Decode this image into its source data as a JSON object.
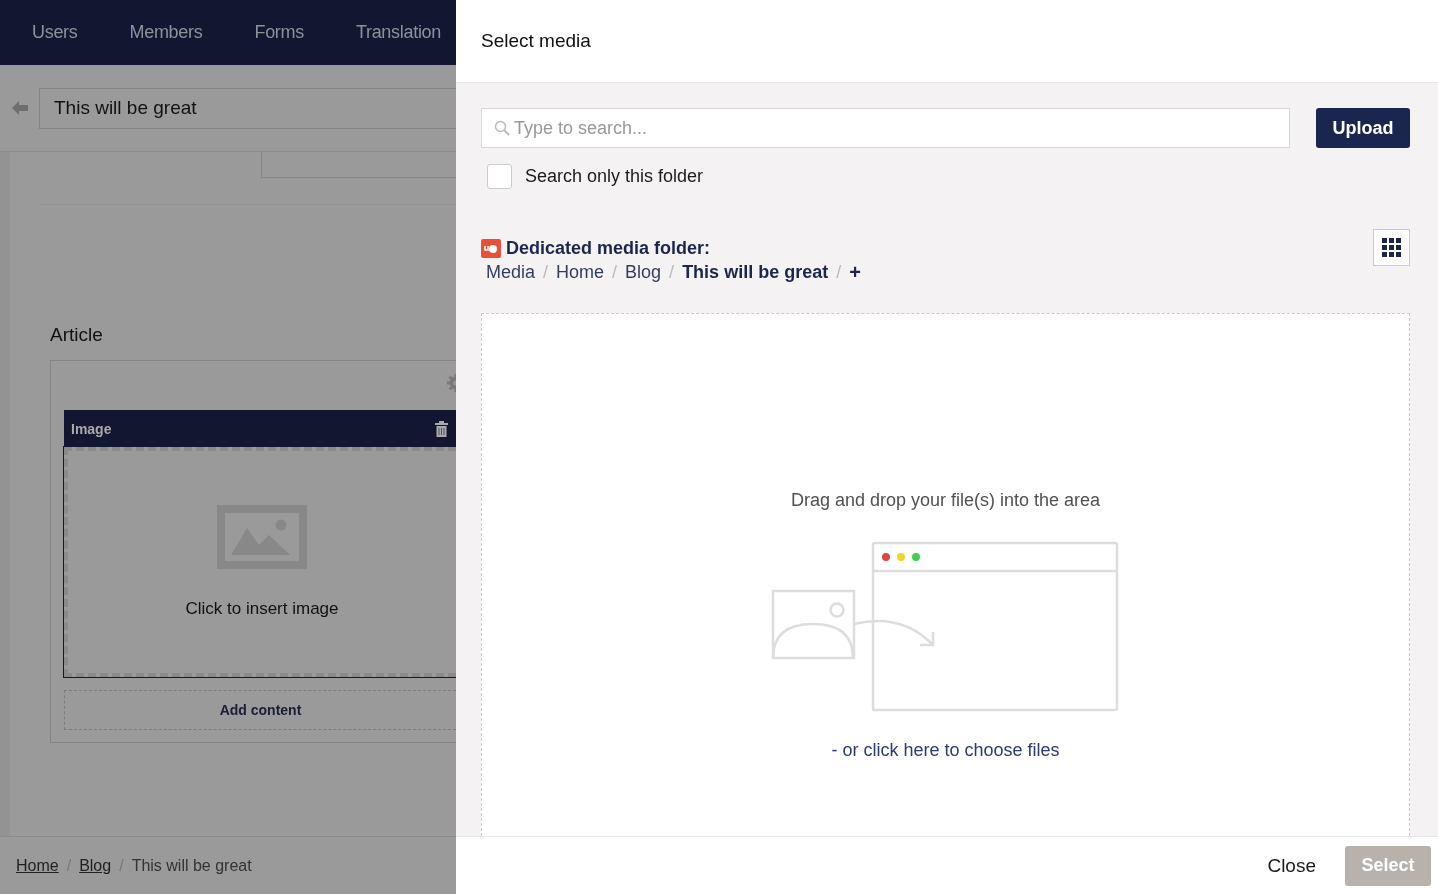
{
  "nav": {
    "items": [
      "Users",
      "Members",
      "Forms",
      "Translation"
    ]
  },
  "editor": {
    "title": "This will be great",
    "section_title": "Article",
    "block": {
      "label": "Image",
      "placeholder": "Click to insert image"
    },
    "add_content": "Add content"
  },
  "page_breadcrumb": [
    {
      "label": "Home",
      "link": true
    },
    {
      "separator": "/",
      "label": "Blog",
      "link": true
    },
    {
      "separator": "/",
      "label": "This will be great",
      "link": false
    }
  ],
  "dialog": {
    "title": "Select media",
    "search": {
      "placeholder": "Type to search..."
    },
    "upload": "Upload",
    "search_only_folder": {
      "label": "Search only this folder",
      "checked": false
    },
    "dedicated_folder": "Dedicated media folder:",
    "breadcrumb": [
      {
        "label": "Media",
        "selected": false
      },
      {
        "separator": "/",
        "label": "Home",
        "selected": false
      },
      {
        "separator": "/",
        "label": "Blog",
        "selected": false
      },
      {
        "separator": "/",
        "label": "This will be great",
        "selected": true
      }
    ],
    "add_folder": {
      "separator": "/",
      "label": "+"
    },
    "drop_text": "Drag and drop your file(s) into the area",
    "choose_text": "- or click here to choose files",
    "footer": {
      "close": "Close",
      "select": {
        "label": "Select",
        "disabled": true
      }
    }
  }
}
